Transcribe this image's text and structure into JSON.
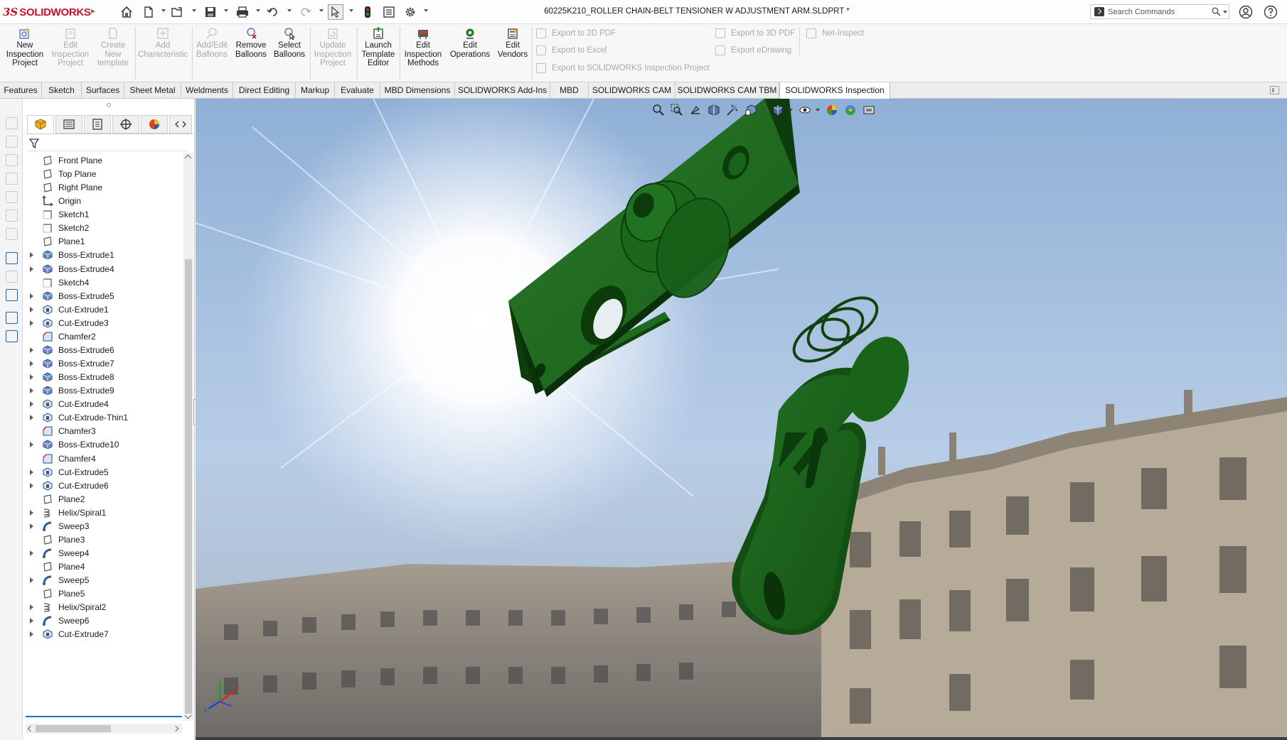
{
  "titlebar": {
    "brand_ds": "3S",
    "brand_name": "SOLIDWORKS",
    "document_title": "60225K210_ROLLER CHAIN-BELT TENSIONER W  ADJUSTMENT ARM.SLDPRT *",
    "search_placeholder": "Search Commands",
    "quick_access_icons": [
      "home-icon",
      "new-file-icon",
      "open-icon",
      "save-icon",
      "print-icon",
      "undo-icon",
      "redo-icon",
      "select-icon",
      "rebuild-icon",
      "file-properties-icon",
      "options-icon"
    ]
  },
  "ribbon": {
    "buttons": [
      {
        "label": "New Inspection Project",
        "lines": [
          "New",
          "Inspection",
          "Project"
        ],
        "enabled": true
      },
      {
        "label": "Edit Inspection Project",
        "lines": [
          "Edit",
          "Inspection",
          "Project"
        ],
        "enabled": false
      },
      {
        "label": "Create New template",
        "lines": [
          "Create",
          "New",
          "template"
        ],
        "enabled": false
      },
      {
        "label": "Add Characteristic",
        "lines": [
          "Add",
          "Characteristic"
        ],
        "enabled": false
      },
      {
        "label": "Add/Edit Balloons",
        "lines": [
          "Add/Edit",
          "Balloons"
        ],
        "enabled": false
      },
      {
        "label": "Remove Balloons",
        "lines": [
          "Remove",
          "Balloons"
        ],
        "enabled": true
      },
      {
        "label": "Select Balloons",
        "lines": [
          "Select",
          "Balloons"
        ],
        "enabled": true
      },
      {
        "label": "Update Inspection Project",
        "lines": [
          "Update",
          "Inspection",
          "Project"
        ],
        "enabled": false
      },
      {
        "label": "Launch Template Editor",
        "lines": [
          "Launch",
          "Template",
          "Editor"
        ],
        "enabled": true
      },
      {
        "label": "Edit Inspection Methods",
        "lines": [
          "Edit",
          "Inspection",
          "Methods"
        ],
        "enabled": true
      },
      {
        "label": "Edit Operations",
        "lines": [
          "Edit",
          "Operations"
        ],
        "enabled": true
      },
      {
        "label": "Edit Vendors",
        "lines": [
          "Edit",
          "Vendors"
        ],
        "enabled": true
      }
    ],
    "exports": {
      "export_2d_pdf": "Export to 2D PDF",
      "export_excel": "Export to Excel",
      "export_inspection_project": "Export to SOLIDWORKS Inspection Project",
      "export_3d_pdf": "Export to 3D PDF",
      "export_edrawing": "Export eDrawing",
      "net_inspect": "Net-Inspect"
    }
  },
  "tabs": [
    "Features",
    "Sketch",
    "Surfaces",
    "Sheet Metal",
    "Weldments",
    "Direct Editing",
    "Markup",
    "Evaluate",
    "MBD Dimensions",
    "SOLIDWORKS Add-Ins",
    "MBD",
    "SOLIDWORKS CAM",
    "SOLIDWORKS CAM TBM",
    "SOLIDWORKS Inspection"
  ],
  "active_tab": "SOLIDWORKS Inspection",
  "feature_tree": [
    {
      "label": "Front Plane",
      "type": "plane",
      "expandable": false
    },
    {
      "label": "Top Plane",
      "type": "plane",
      "expandable": false
    },
    {
      "label": "Right Plane",
      "type": "plane",
      "expandable": false
    },
    {
      "label": "Origin",
      "type": "origin",
      "expandable": false
    },
    {
      "label": "Sketch1",
      "type": "sketch",
      "expandable": false
    },
    {
      "label": "Sketch2",
      "type": "sketch",
      "expandable": false
    },
    {
      "label": "Plane1",
      "type": "plane",
      "expandable": false
    },
    {
      "label": "Boss-Extrude1",
      "type": "boss",
      "expandable": true
    },
    {
      "label": "Boss-Extrude4",
      "type": "boss",
      "expandable": true
    },
    {
      "label": "Sketch4",
      "type": "sketch",
      "expandable": false
    },
    {
      "label": "Boss-Extrude5",
      "type": "boss",
      "expandable": true
    },
    {
      "label": "Cut-Extrude1",
      "type": "cut",
      "expandable": true
    },
    {
      "label": "Cut-Extrude3",
      "type": "cut",
      "expandable": true
    },
    {
      "label": "Chamfer2",
      "type": "chamfer",
      "expandable": false
    },
    {
      "label": "Boss-Extrude6",
      "type": "boss",
      "expandable": true
    },
    {
      "label": "Boss-Extrude7",
      "type": "boss",
      "expandable": true
    },
    {
      "label": "Boss-Extrude8",
      "type": "boss",
      "expandable": true
    },
    {
      "label": "Boss-Extrude9",
      "type": "boss",
      "expandable": true
    },
    {
      "label": "Cut-Extrude4",
      "type": "cut",
      "expandable": true
    },
    {
      "label": "Cut-Extrude-Thin1",
      "type": "cut",
      "expandable": true
    },
    {
      "label": "Chamfer3",
      "type": "chamfer",
      "expandable": false
    },
    {
      "label": "Boss-Extrude10",
      "type": "boss",
      "expandable": true
    },
    {
      "label": "Chamfer4",
      "type": "chamfer",
      "expandable": false
    },
    {
      "label": "Cut-Extrude5",
      "type": "cut",
      "expandable": true
    },
    {
      "label": "Cut-Extrude6",
      "type": "cut",
      "expandable": true
    },
    {
      "label": "Plane2",
      "type": "plane",
      "expandable": false
    },
    {
      "label": "Helix/Spiral1",
      "type": "helix",
      "expandable": true
    },
    {
      "label": "Sweep3",
      "type": "sweep",
      "expandable": true
    },
    {
      "label": "Plane3",
      "type": "plane",
      "expandable": false
    },
    {
      "label": "Sweep4",
      "type": "sweep",
      "expandable": true
    },
    {
      "label": "Plane4",
      "type": "plane",
      "expandable": false
    },
    {
      "label": "Sweep5",
      "type": "sweep",
      "expandable": true
    },
    {
      "label": "Plane5",
      "type": "plane",
      "expandable": false
    },
    {
      "label": "Helix/Spiral2",
      "type": "helix",
      "expandable": true
    },
    {
      "label": "Sweep6",
      "type": "sweep",
      "expandable": true
    },
    {
      "label": "Cut-Extrude7",
      "type": "cut",
      "expandable": true
    }
  ],
  "feature_manager_tabs": [
    "featuremanager-tree-icon",
    "property-manager-icon",
    "configuration-manager-icon",
    "dimxpert-manager-icon",
    "display-manager-icon"
  ],
  "heads_up_toolbar": [
    "zoom-to-fit-icon",
    "zoom-to-area-icon",
    "previous-view-icon",
    "section-view-icon",
    "dynamic-annotation-icon",
    "view-orientation-icon",
    "display-style-icon",
    "hide-show-icon",
    "edit-appearance-icon",
    "apply-scene-icon",
    "view-settings-icon"
  ],
  "colors": {
    "brand_red": "#c8102e",
    "part_green": "#1f6b1f",
    "part_dark": "#0d3d0d",
    "active_blue": "#1f6fc4"
  }
}
